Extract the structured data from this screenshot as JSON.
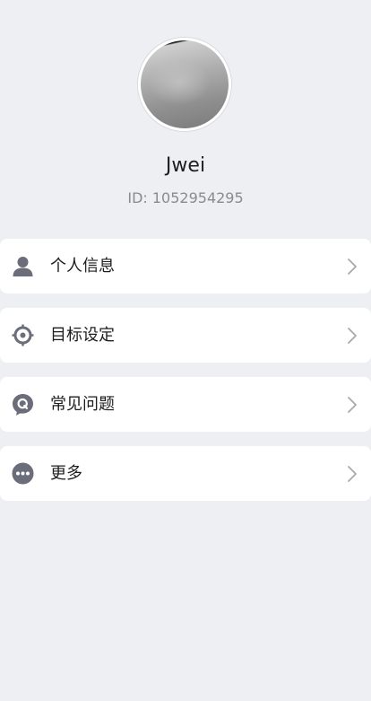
{
  "profile": {
    "name": "Jwei",
    "id_text": "ID: 1052954295"
  },
  "menu": {
    "items": [
      {
        "label": "个人信息",
        "icon": "user-icon"
      },
      {
        "label": "目标设定",
        "icon": "target-icon"
      },
      {
        "label": "常见问题",
        "icon": "question-icon"
      },
      {
        "label": "更多",
        "icon": "more-icon"
      }
    ]
  },
  "colors": {
    "background": "#eeeff3",
    "card": "#ffffff",
    "icon": "#6b6d7a",
    "chevron": "#a9a9ae",
    "text_primary": "#1e1e1e",
    "text_secondary": "#8a8a8f"
  }
}
